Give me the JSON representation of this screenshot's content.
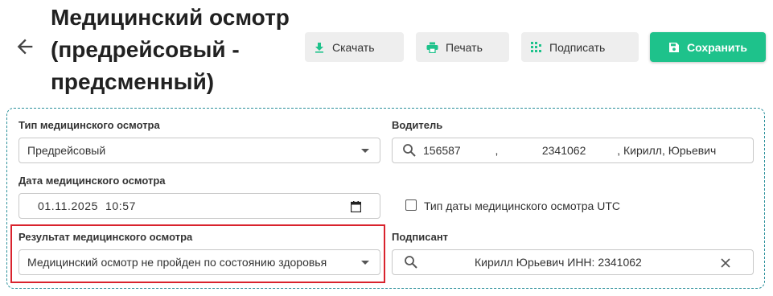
{
  "header": {
    "title": "Медицинский осмотр (предрейсовый - предсменный)",
    "buttons": {
      "download": "Скачать",
      "print": "Печать",
      "sign": "Подписать",
      "save": "Сохранить"
    }
  },
  "form": {
    "exam_type": {
      "label": "Тип медицинского осмотра",
      "value": "Предрейсовый"
    },
    "driver": {
      "label": "Водитель",
      "value": "156587           ,              2341062          , Кирилл, Юрьевич"
    },
    "exam_date": {
      "label": "Дата медицинского осмотра",
      "value": "01.11.2025  10:57"
    },
    "utc_checkbox": {
      "label": "Тип даты медицинского осмотра UTC",
      "checked": false
    },
    "result": {
      "label": "Результат медицинского осмотра",
      "value": "Медицинский осмотр не пройден по состоянию здоровья"
    },
    "signer": {
      "label": "Подписант",
      "value": "Кирилл Юрьевич ИНН: 2341062"
    }
  },
  "colors": {
    "accent": "#1ec28b",
    "highlight": "#d9232d",
    "panel_border": "#2a8f9a"
  }
}
